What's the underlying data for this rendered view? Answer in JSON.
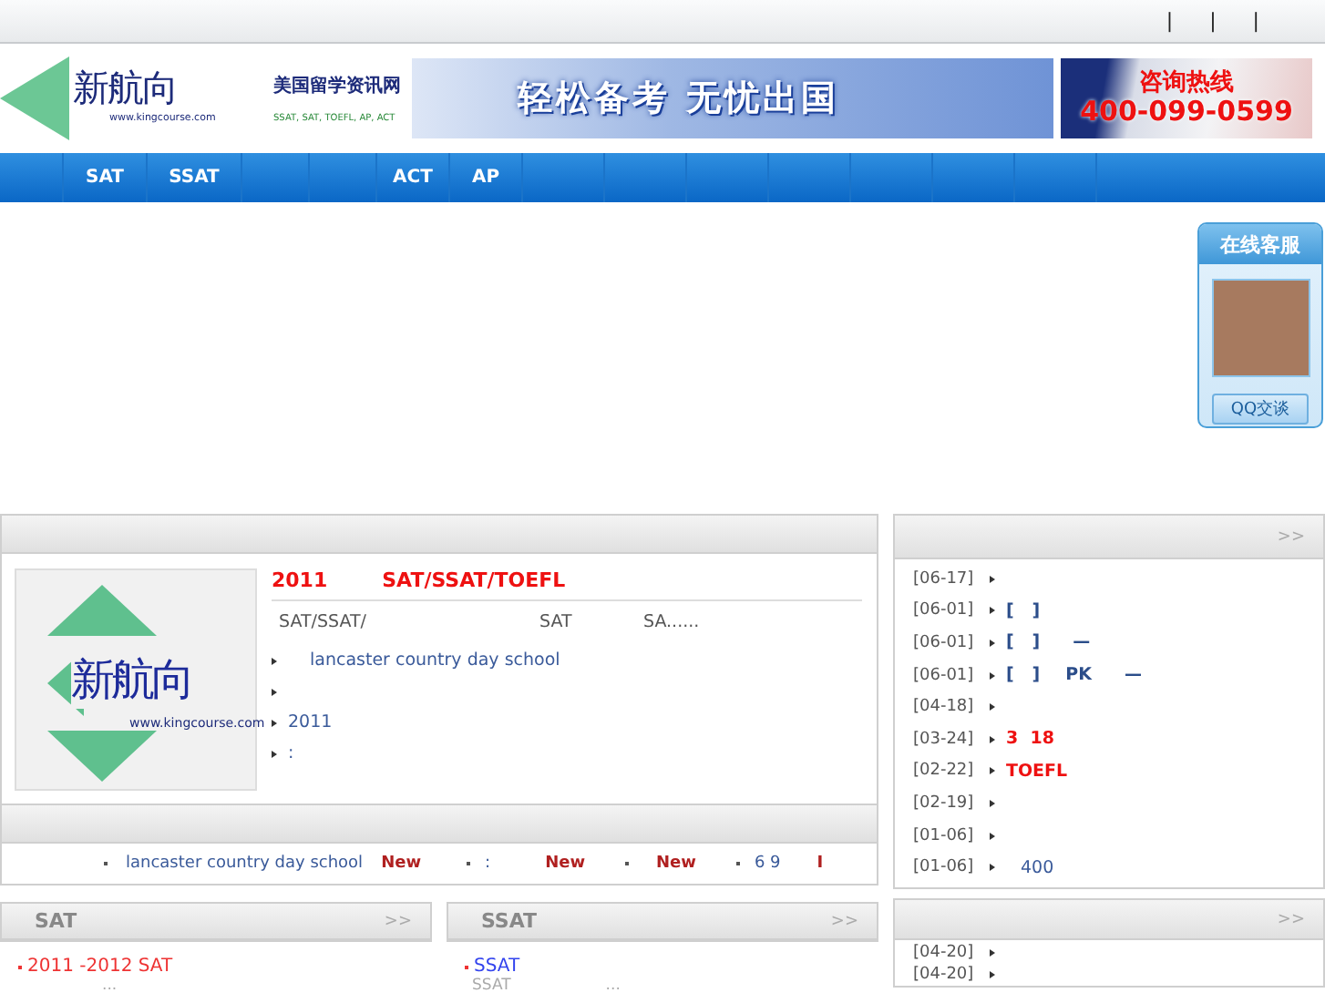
{
  "top_bar": {
    "separators": [
      "|",
      "|",
      "|"
    ]
  },
  "header": {
    "logo": {
      "mark": "新航向",
      "url": "www.kingcourse.com"
    },
    "tagline": {
      "title": "美国留学资讯网",
      "subjects": "SSAT, SAT, TOEFL, AP, ACT"
    },
    "banner": {
      "slogan": "轻松备考 无忧出国"
    },
    "hotline": {
      "label": "咨询热线",
      "number": "400-099-0599"
    }
  },
  "nav": [
    {
      "label": "SAT"
    },
    {
      "label": "SSAT"
    },
    {
      "label": "ACT"
    },
    {
      "label": "AP"
    }
  ],
  "service_widget": {
    "title": "在线客服",
    "button": "QQ交谈"
  },
  "featured": {
    "logo": {
      "mark": "新航向",
      "url": "www.kingcourse.com"
    },
    "title": [
      {
        "text": "2011"
      },
      {
        "text": "SAT/SSAT/TOEFL"
      }
    ],
    "summary": [
      {
        "text": "SAT/SSAT/"
      },
      {
        "text": "SAT"
      },
      {
        "text": "SA......"
      }
    ],
    "links": [
      {
        "kind": "link",
        "text": "lancaster country day school"
      },
      {
        "kind": "blank"
      },
      {
        "kind": "link",
        "text": "2011"
      },
      {
        "kind": "link",
        "text": ":"
      }
    ]
  },
  "ticker": [
    {
      "text": "lancaster country day school",
      "badge": "New"
    },
    {
      "text": ":",
      "badge": "New"
    },
    {
      "badge": "New"
    },
    {
      "text": "6 9",
      "badge": "I"
    }
  ],
  "news": {
    "more": ">>",
    "items": [
      {
        "date": "[06-17]"
      },
      {
        "date": "[06-01]",
        "parts": [
          {
            "text": "[   ]",
            "kind": "tag"
          }
        ]
      },
      {
        "date": "[06-01]",
        "parts": [
          {
            "text": "[   ]",
            "kind": "tag"
          },
          {
            "text": "—",
            "kind": "tag"
          }
        ]
      },
      {
        "date": "[06-01]",
        "parts": [
          {
            "text": "[   ]",
            "kind": "tag"
          },
          {
            "text": "PK",
            "kind": "tag"
          },
          {
            "text": "—",
            "kind": "tag"
          }
        ]
      },
      {
        "date": "[04-18]"
      },
      {
        "date": "[03-24]",
        "parts": [
          {
            "text": "3  18",
            "kind": "hot"
          }
        ]
      },
      {
        "date": "[02-22]",
        "parts": [
          {
            "text": "TOEFL",
            "kind": "hot"
          }
        ]
      },
      {
        "date": "[02-19]"
      },
      {
        "date": "[01-06]"
      },
      {
        "date": "[01-06]",
        "parts": [
          {
            "text": "400",
            "kind": "plain"
          }
        ]
      }
    ]
  },
  "sat_panel": {
    "title": "SAT",
    "more": ">>",
    "item": "2011   -2012   SAT",
    "note": "..."
  },
  "ssat_panel": {
    "title": "SSAT",
    "more": ">>",
    "item": "SSAT",
    "note_left": "SSAT",
    "note_right": "..."
  },
  "news2": {
    "more": ">>",
    "items": [
      {
        "date": "[04-20]"
      },
      {
        "date": "[04-20]"
      }
    ]
  }
}
